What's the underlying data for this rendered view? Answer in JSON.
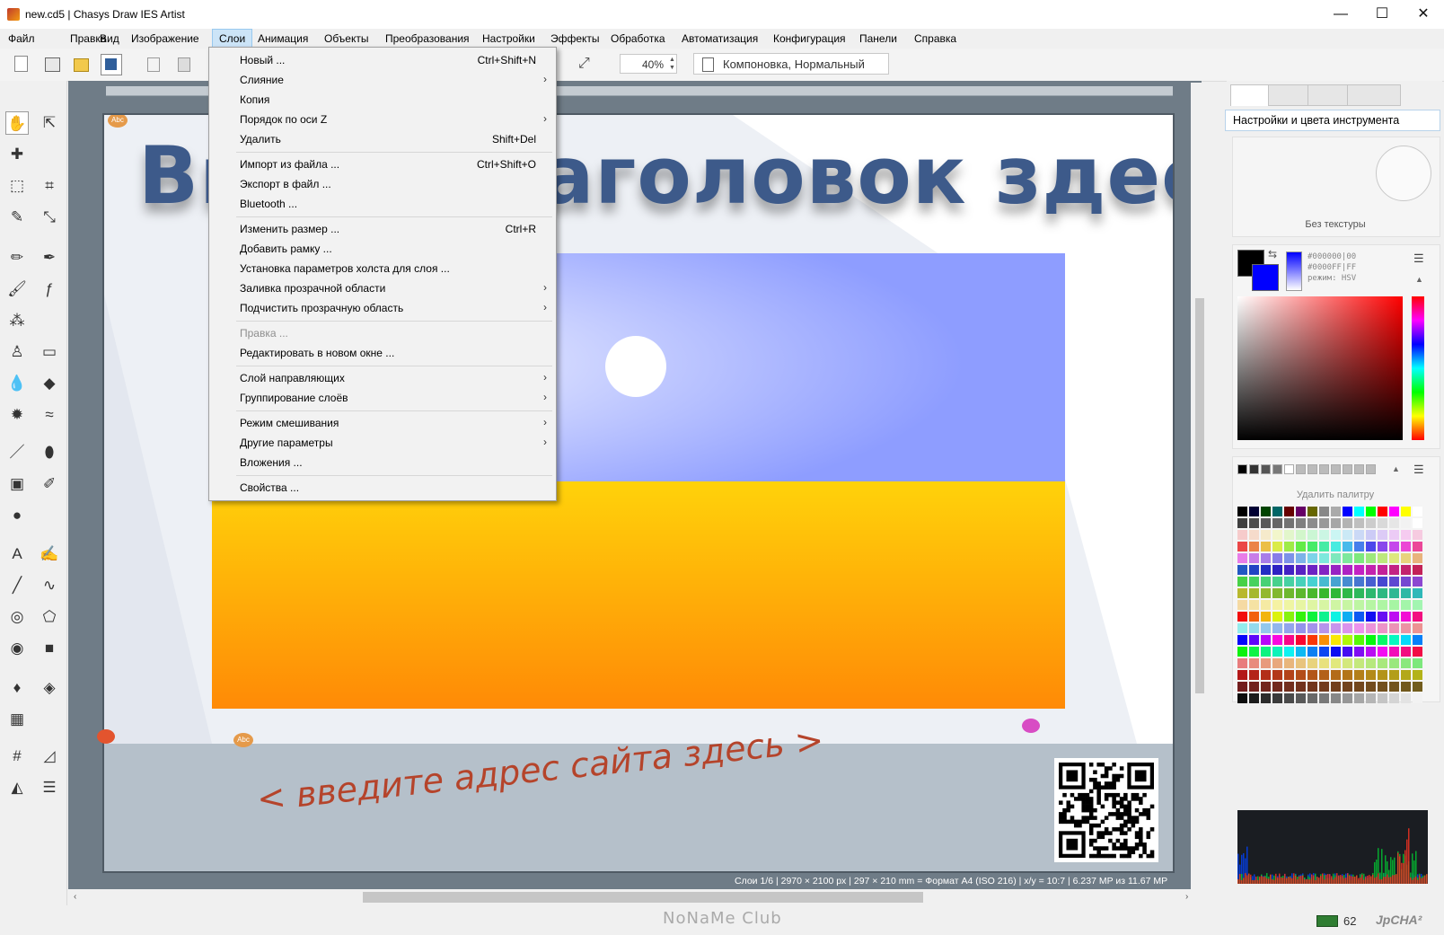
{
  "window": {
    "title": "new.cd5 | Chasys Draw IES Artist",
    "minimize": "—",
    "maximize": "☐",
    "close": "✕"
  },
  "menubar": [
    "Файл",
    "Правка",
    "Вид",
    "Изображение",
    "Слои",
    "Анимация",
    "Объекты",
    "Преобразования",
    "Настройки",
    "Эффекты",
    "Обработка",
    "Автоматизация",
    "Конфигурация",
    "Панели",
    "Справка"
  ],
  "active_menu": "Слои",
  "toolbar": {
    "zoom": "40%",
    "composite_mode": "Компоновка, Нормальный"
  },
  "dropdown": [
    {
      "label": "Новый ...",
      "shortcut": "Ctrl+Shift+N"
    },
    {
      "label": "Слияние",
      "submenu": true
    },
    {
      "label": "Копия"
    },
    {
      "label": "Порядок по оси Z",
      "submenu": true
    },
    {
      "label": "Удалить",
      "shortcut": "Shift+Del"
    },
    {
      "separator": true
    },
    {
      "label": "Импорт из файла ...",
      "shortcut": "Ctrl+Shift+O"
    },
    {
      "label": "Экспорт в файл ..."
    },
    {
      "label": "Bluetooth ..."
    },
    {
      "separator": true
    },
    {
      "label": "Изменить размер ...",
      "shortcut": "Ctrl+R"
    },
    {
      "label": "Добавить рамку ..."
    },
    {
      "label": "Установка параметров холста для слоя ..."
    },
    {
      "label": "Заливка прозрачной области",
      "submenu": true
    },
    {
      "label": "Подчистить прозрачную область",
      "submenu": true
    },
    {
      "separator": true
    },
    {
      "label": "Правка ...",
      "disabled": true
    },
    {
      "label": "Редактировать в новом окне ..."
    },
    {
      "separator": true
    },
    {
      "label": "Слой направляющих",
      "submenu": true
    },
    {
      "label": "Группирование слоёв",
      "submenu": true
    },
    {
      "separator": true
    },
    {
      "label": "Режим смешивания",
      "submenu": true
    },
    {
      "label": "Другие параметры",
      "submenu": true
    },
    {
      "label": "Вложения ..."
    },
    {
      "separator": true
    },
    {
      "label": "Свойства ..."
    }
  ],
  "canvas": {
    "headline_visible": "Вв",
    "headline_rest": "аголовок здесь",
    "subline": "< введите адрес сайта здесь >",
    "status": "Слои 1/6 | 2970 × 2100 px | 297 × 210 mm = Формат A4 (ISO 216) | x/y = 10:7 | 6.237 MP из 11.67 MP"
  },
  "right_panel": {
    "header": "Настройки и цвета инструмента",
    "texture_label": "Без текстуры",
    "hex_fg": "#000000|00",
    "hex_bg": "#0000FF|FF",
    "mode": "режим: HSV",
    "palette_label": "Удалить палитру"
  },
  "statusbar": {
    "watermark": "NoNaMe Club",
    "count": "62",
    "brand": "JpCHA²"
  },
  "colors": {
    "menu_active": "#cce4f7",
    "sky_top": "#9aa8ff",
    "sand_top": "#ffd20a",
    "sand_bottom": "#ff8a06",
    "subline_text": "#b5442b",
    "headline_text": "#3d5a8a"
  }
}
